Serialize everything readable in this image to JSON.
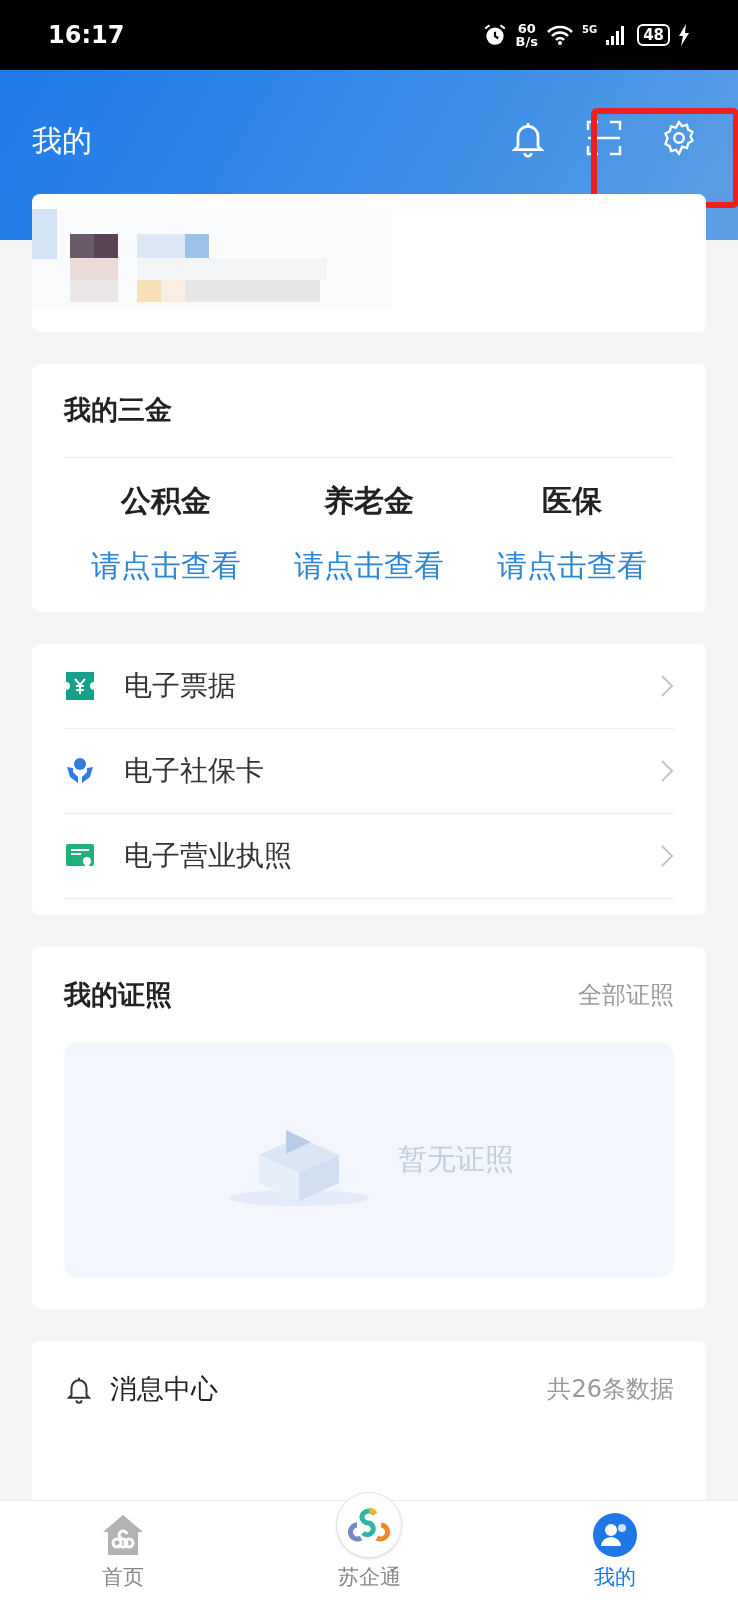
{
  "status_bar": {
    "time": "16:17",
    "net_speed": "60",
    "net_unit": "B/s",
    "network": "5G",
    "battery": "48"
  },
  "header": {
    "title": "我的"
  },
  "funds": {
    "title": "我的三金",
    "items": [
      {
        "label": "公积金",
        "action": "请点击查看"
      },
      {
        "label": "养老金",
        "action": "请点击查看"
      },
      {
        "label": "医保",
        "action": "请点击查看"
      }
    ]
  },
  "services": [
    {
      "kind": "ticket",
      "label": "电子票据"
    },
    {
      "kind": "social",
      "label": "电子社保卡"
    },
    {
      "kind": "license",
      "label": "电子营业执照"
    }
  ],
  "licenses": {
    "title": "我的证照",
    "link": "全部证照",
    "empty": "暂无证照"
  },
  "messages": {
    "title": "消息中心",
    "count": "共26条数据"
  },
  "tab_bar": [
    {
      "label": "首页",
      "selected": false
    },
    {
      "label": "苏企通",
      "selected": false
    },
    {
      "label": "我的",
      "selected": true
    }
  ],
  "annotation": {
    "shown": true
  }
}
